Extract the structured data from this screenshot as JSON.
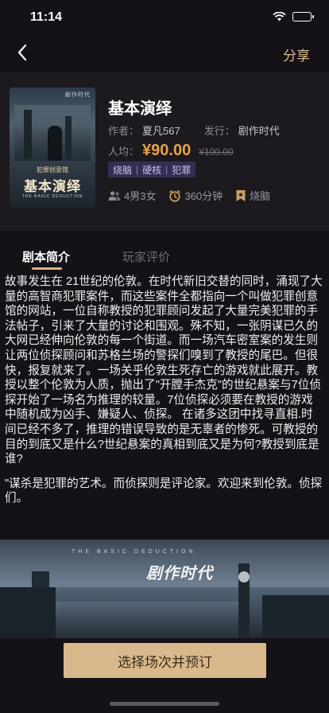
{
  "status_bar": {
    "time": "11:14"
  },
  "nav": {
    "back_icon": "chevron-left-icon",
    "share_label": "分享"
  },
  "script": {
    "title": "基本演绎",
    "author_label": "作者：",
    "author": "夏凡567",
    "publisher_label": "发行：",
    "publisher": "剧作时代",
    "price_label": "人均：",
    "price": "¥90.00",
    "original_price": "¥100.00",
    "tags": [
      "烧脑",
      "硬核",
      "犯罪"
    ],
    "players": "4男3女",
    "duration": "360分钟",
    "category": "烧脑"
  },
  "poster": {
    "top_mark": "剧作时代",
    "subtitle": "犯罪创意馆",
    "title": "基本演绎",
    "english": "THE BASIC DEDUCTION"
  },
  "tabs": [
    {
      "label": "剧本简介",
      "active": true
    },
    {
      "label": "玩家评价",
      "active": false
    }
  ],
  "description": {
    "body": "故事发生在 21世纪的伦敦。在时代新旧交替的同时，涌现了大量的高智商犯罪案件，而这些案件全都指向一个叫做犯罪创意馆的网站，一位自称教授的犯罪顾问发起了大量完美犯罪的手法帖子，引来了大量的讨论和围观。殊不知，一张阴谋已久的大网已经伸向伦敦的每一个街道。而一场汽车密室案的发生则让两位侦探顾问和苏格兰场的警探们嗅到了教授的尾巴。但很快，报复就来了。一场关乎伦敦生死存亡的游戏就此展开。教授以整个伦敦为人质，抛出了\"开膛手杰克\"的世纪悬案与7位侦探开始了一场名为推理的较量。7位侦探必须要在教授的游戏中随机成为凶手、嫌疑人、侦探。 在诸多这团中找寻直相.时间已经不多了，推理的错误导致的是无辜者的惨死。可教授的目的到底又是什么?世纪悬案的真相到底又是为何?教授到底是谁?",
    "quote": "\"谋杀是犯罪的艺术。而侦探则是评论家。欢迎来到伦敦。侦探们。"
  },
  "banner": {
    "english": "THE BASIC DEDUCTION",
    "logo": "剧作时代"
  },
  "actions": {
    "book_label": "选择场次并预订"
  },
  "colors": {
    "accent": "#d9b98b",
    "price": "#e8a14a",
    "tag_bg": "#362d52",
    "background": "#141217"
  }
}
